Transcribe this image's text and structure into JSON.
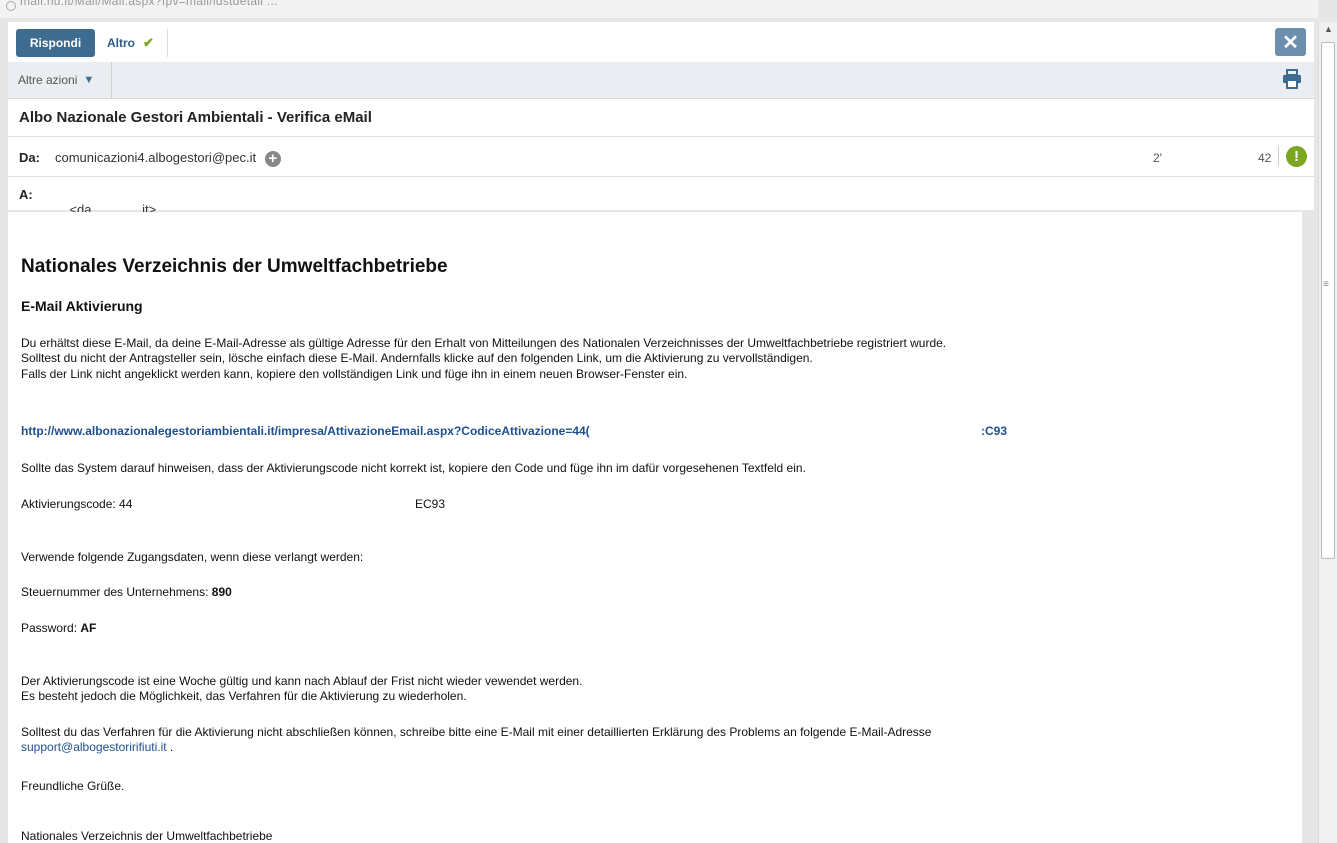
{
  "browser": {
    "url": "mail.nu.it/Mail/Mail.aspx?fpv=mail/ldstdetail ..."
  },
  "toolbar": {
    "reply_label": "Rispondi",
    "more_label": "Altro",
    "close_label": "✕"
  },
  "actions": {
    "other_actions_label": "Altre azioni"
  },
  "message": {
    "subject": "Albo Nazionale Gestori Ambientali - Verifica eMail",
    "from_label": "Da:",
    "from_value": "comunicazioni4.albogestori@pec.it",
    "date_part1": "2'",
    "date_part2": "42",
    "to_label": "A:",
    "to_value": "<da              it>"
  },
  "body": {
    "heading": "Nationales Verzeichnis der Umweltfachbetriebe",
    "subheading": "E-Mail Aktivierung",
    "intro_line1": "Du erhältst diese E-Mail, da deine E-Mail-Adresse als gültige Adresse für den Erhalt von Mitteilungen des Nationalen Verzeichnisses der Umweltfachbetriebe registriert wurde.",
    "intro_line2": "Solltest du nicht der Antragsteller sein, lösche einfach diese E-Mail. Andernfalls klicke auf den folgenden Link, um die Aktivierung zu vervollständigen.",
    "intro_line3": "Falls der Link nicht angeklickt werden kann, kopiere den vollständigen Link und füge ihn in einem neuen Browser-Fenster ein.",
    "activation_link_start": "http://www.albonazionalegestoriambientali.it/impresa/AttivazioneEmail.aspx?CodiceAttivazione=44(",
    "activation_link_end": ":C93",
    "system_note": "Sollte das System darauf hinweisen, dass der Aktivierungscode nicht korrekt ist, kopiere den Code und füge ihn im dafür vorgesehenen Textfeld ein.",
    "code_label": "Aktivierungscode: 44",
    "code_end": "EC93",
    "credentials_intro": "Verwende folgende Zugangsdaten, wenn diese verlangt werden:",
    "tax_label": "Steuernummer des Unternehmens: ",
    "tax_value": "890",
    "password_label": "Password: ",
    "password_value": "AF",
    "validity_line1": "Der Aktivierungscode ist eine Woche gültig und kann nach Ablauf der Frist nicht wieder vewendet werden.",
    "validity_line2": "Es besteht jedoch die Möglichkeit, das Verfahren für die Aktivierung zu wiederholen.",
    "support_line": "Solltest du das Verfahren für die Aktivierung nicht abschließen können, schreibe bitte eine E-Mail mit einer detaillierten Erklärung des Problems an folgende E-Mail-Adresse",
    "support_email": "support@albogestoririfiuti.it",
    "support_suffix": " .",
    "greeting": "Freundliche Grüße.",
    "signature": "Nationales Verzeichnis der Umweltfachbetriebe"
  },
  "icons": {
    "alert": "!",
    "plus": "+"
  },
  "colors": {
    "reply_button": "#3e6c91",
    "accent_green": "#7aa621",
    "link": "#1f4f8f"
  }
}
